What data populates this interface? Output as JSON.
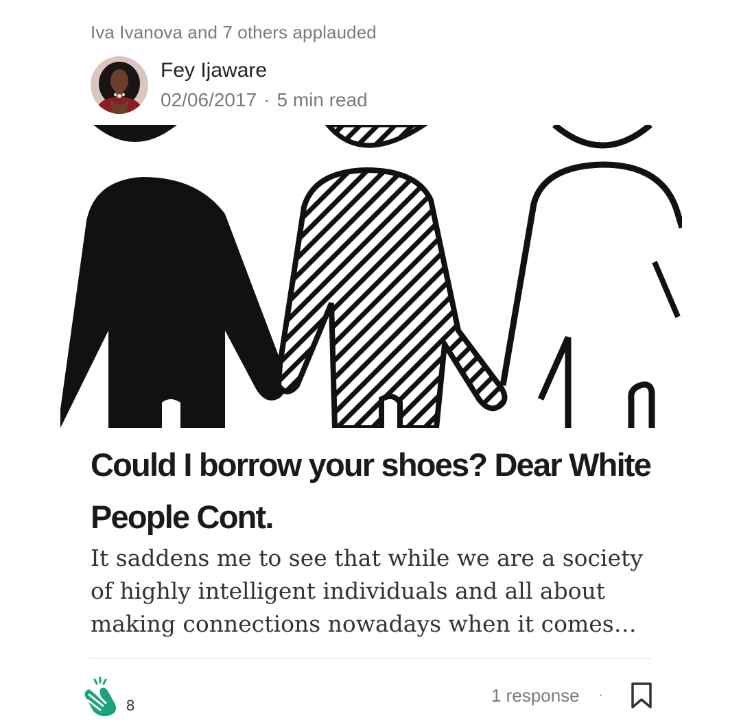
{
  "feed": {
    "applauded_by": "Iva Ivanova and 7 others applauded"
  },
  "author": {
    "name": "Fey Ijaware",
    "date": "02/06/2017",
    "separator": "·",
    "read_time": "5 min read"
  },
  "article": {
    "title": "Could I borrow your shoes? Dear White People Cont.",
    "excerpt": "It saddens me to see that while we are a society of highly intelligent individuals and all about making connections nowadays when it comes…"
  },
  "footer": {
    "clap_count": "8",
    "responses": "1 response",
    "separator": "·"
  },
  "icons": {
    "clap": "clap-icon",
    "bookmark": "bookmark-icon"
  },
  "colors": {
    "clap_green": "#1aa37a",
    "meta_gray": "#7a7a7a",
    "title": "#1a1a1a"
  }
}
